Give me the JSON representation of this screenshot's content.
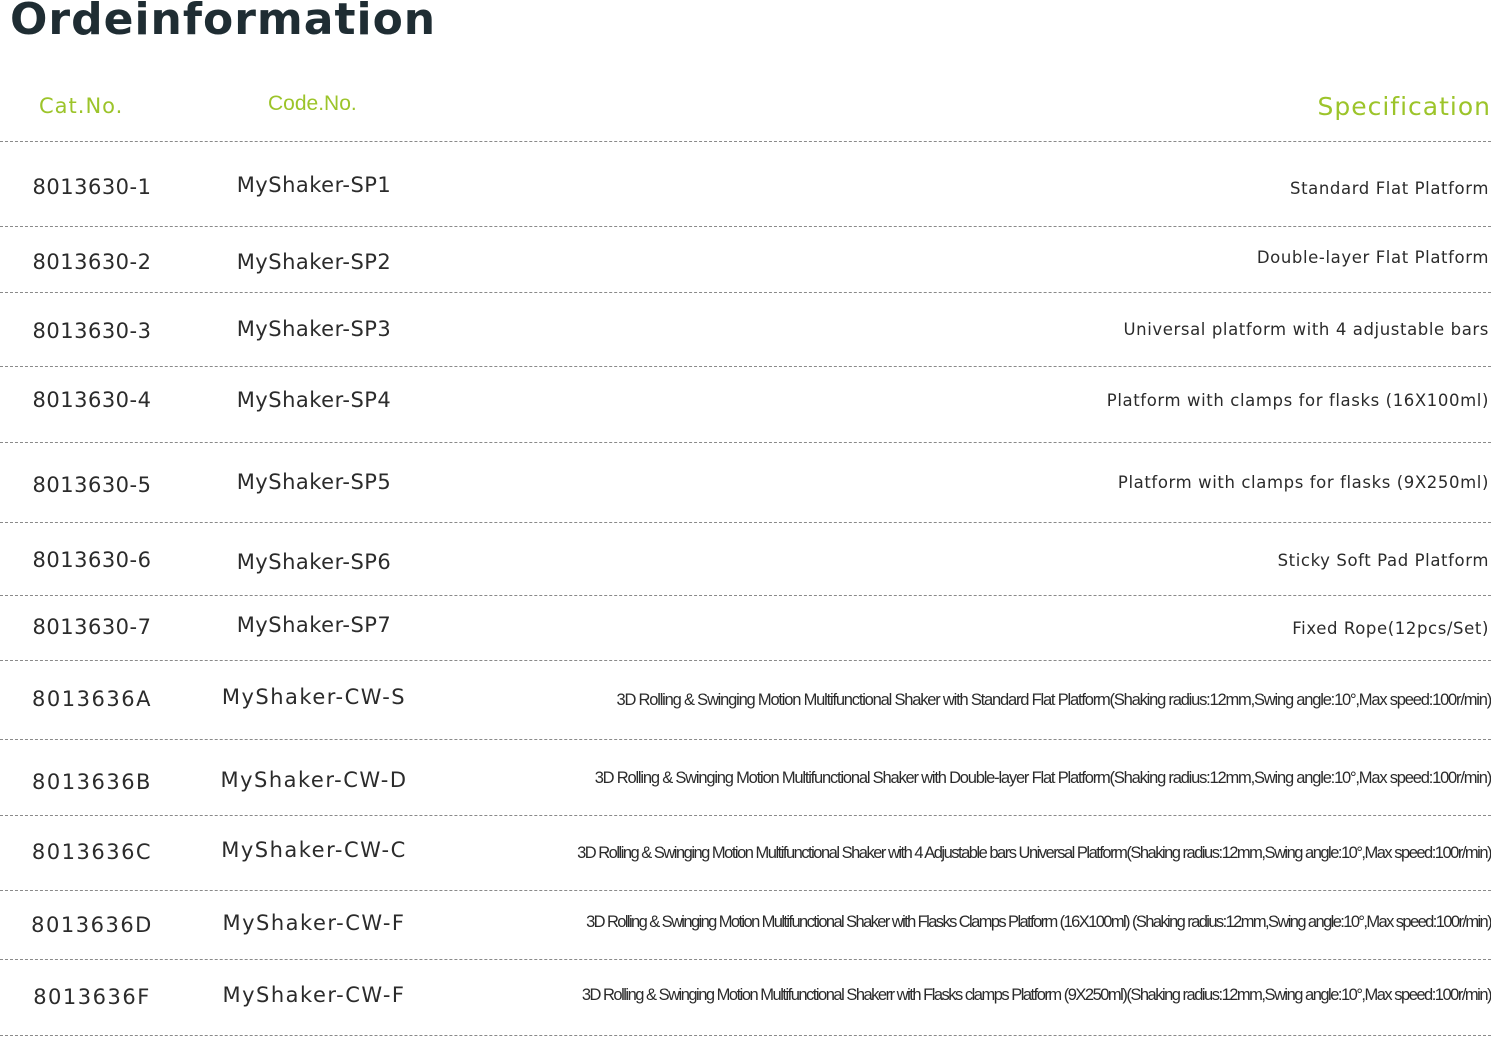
{
  "title": "Ordeinformation",
  "headers": {
    "cat_no": "Cat.No.",
    "code_no": "Code.No.",
    "specification": "Specification"
  },
  "colors": {
    "title": "#1f2d33",
    "header_accent": "#9cc42a",
    "body_text": "#2b2b2b",
    "rule": "#8a8a8a"
  },
  "rows": [
    {
      "cat_no": "8013630-1",
      "code_no": "MyShaker-SP1",
      "specification": "Standard Flat Platform"
    },
    {
      "cat_no": "8013630-2",
      "code_no": "MyShaker-SP2",
      "specification": "Double-layer Flat Platform"
    },
    {
      "cat_no": "8013630-3",
      "code_no": "MyShaker-SP3",
      "specification": "Universal platform with 4 adjustable bars"
    },
    {
      "cat_no": "8013630-4",
      "code_no": "MyShaker-SP4",
      "specification": "Platform with clamps for flasks (16X100ml)"
    },
    {
      "cat_no": "8013630-5",
      "code_no": "MyShaker-SP5",
      "specification": "Platform with clamps for flasks (9X250ml)"
    },
    {
      "cat_no": "8013630-6",
      "code_no": "MyShaker-SP6",
      "specification": "Sticky Soft Pad Platform"
    },
    {
      "cat_no": "8013630-7",
      "code_no": "MyShaker-SP7",
      "specification": "Fixed Rope(12pcs/Set)"
    },
    {
      "cat_no": "8013636A",
      "code_no": "MyShaker-CW-S",
      "specification": "3D Rolling & Swinging Motion Multifunctional Shaker with Standard Flat Platform(Shaking radius:12mm,Swing angle:10°,Max speed:100r/min)"
    },
    {
      "cat_no": "8013636B",
      "code_no": "MyShaker-CW-D",
      "specification": "3D Rolling & Swinging Motion Multifunctional Shaker with Double-layer Flat Platform(Shaking radius:12mm,Swing angle:10°,Max speed:100r/min)"
    },
    {
      "cat_no": "8013636C",
      "code_no": "MyShaker-CW-C",
      "specification": "3D Rolling & Swinging Motion Multifunctional Shaker with 4 Adjustable bars Universal Platform(Shaking radius:12mm,Swing angle:10°,Max speed:100r/min)"
    },
    {
      "cat_no": "8013636D",
      "code_no": "MyShaker-CW-F",
      "specification": "3D Rolling & Swinging Motion Multifunctional Shaker with Flasks Clamps Platform (16X100ml) (Shaking radius:12mm,Swing angle:10°,Max speed:100r/min)"
    },
    {
      "cat_no": "8013636F",
      "code_no": "MyShaker-CW-F",
      "specification": "3D Rolling & Swinging Motion Multifunctional Shakerr with Flasks clamps Platform (9X250ml)(Shaking radius:12mm,Swing angle:10°,Max speed:100r/min)"
    }
  ]
}
